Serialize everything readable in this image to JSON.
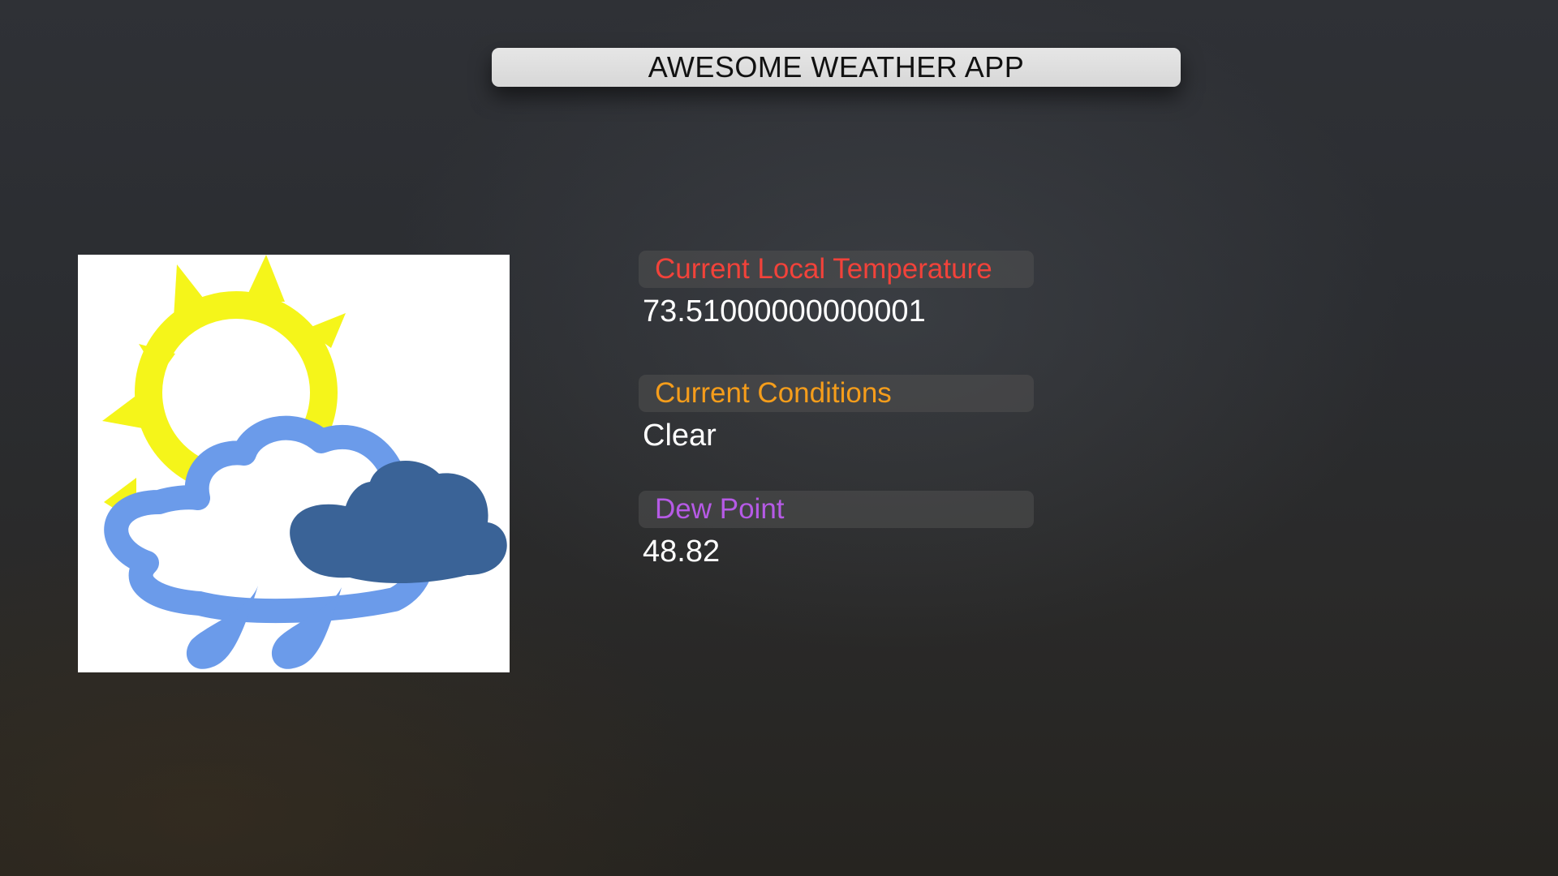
{
  "app": {
    "title": "AWESOME WEATHER APP"
  },
  "weather_icon": {
    "name": "partly-cloudy-rain-icon"
  },
  "readings": {
    "temperature": {
      "label": "Current Local Temperature",
      "value": "73.51000000000001",
      "color": "#f2423a"
    },
    "conditions": {
      "label": "Current Conditions",
      "value": "Clear",
      "color": "#f59d1b"
    },
    "dew_point": {
      "label": "Dew Point",
      "value": "48.82",
      "color": "#b65ae6"
    }
  },
  "colors": {
    "title_bar": "#dcdcdc",
    "sun": "#f5f51a",
    "light_cloud": "#6b9bea",
    "dark_cloud": "#3a6397",
    "raindrop": "#6b9bea"
  }
}
